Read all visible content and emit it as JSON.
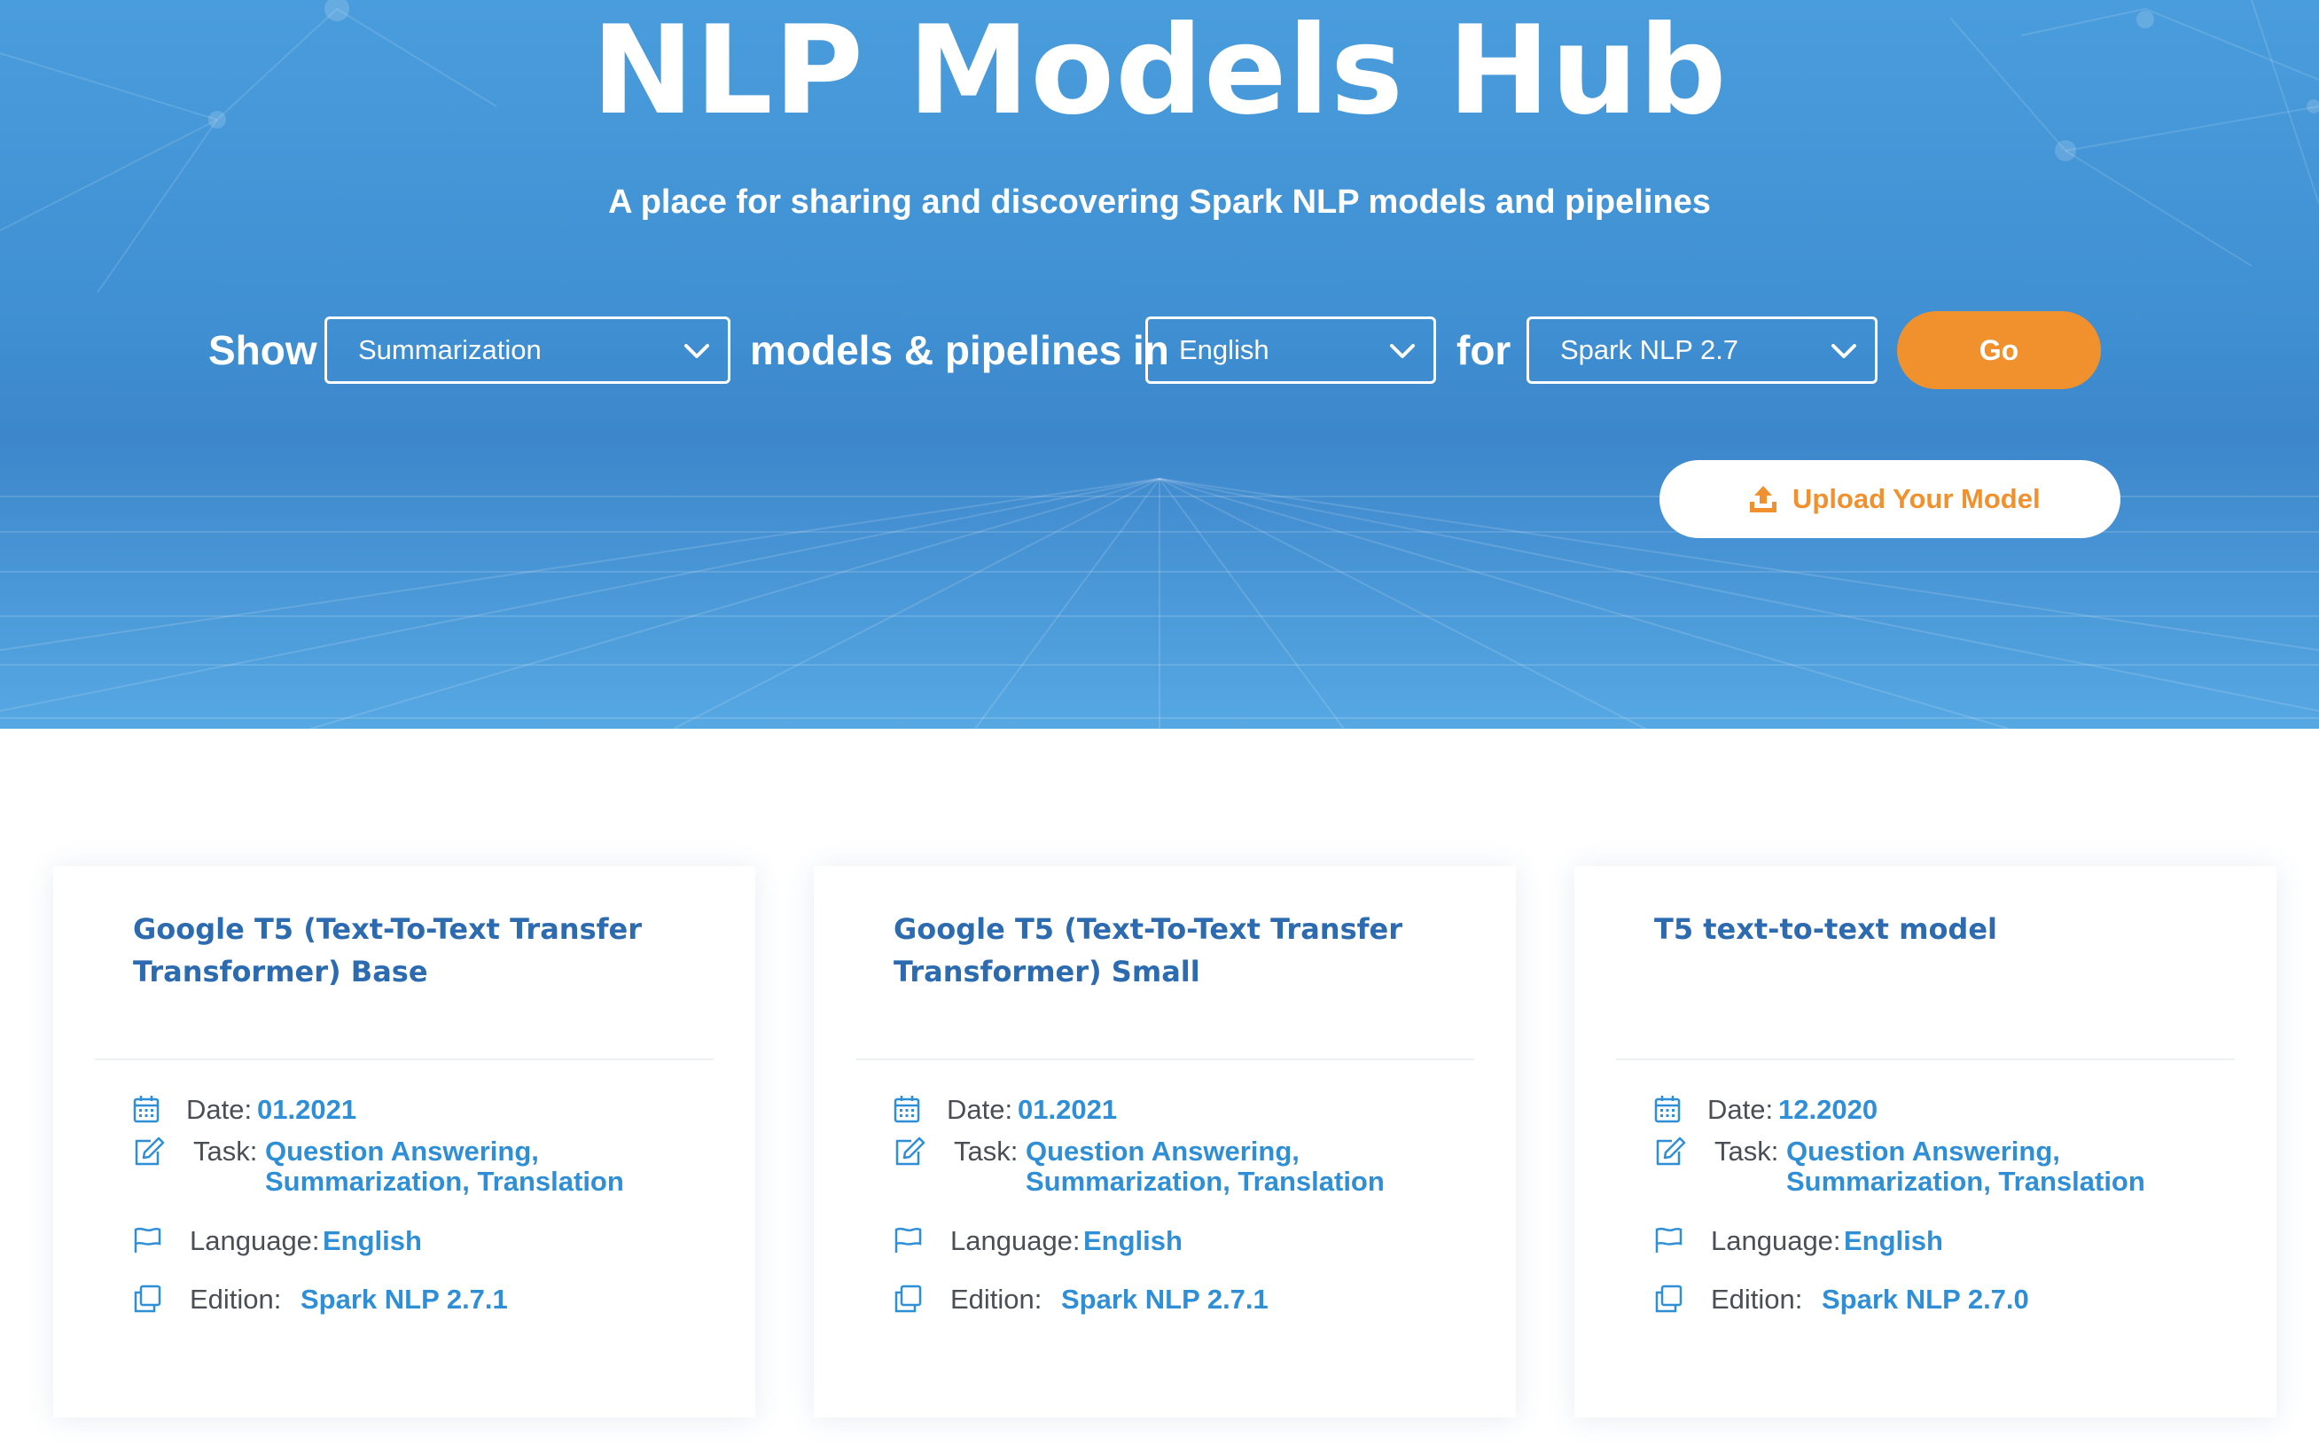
{
  "hero": {
    "title": "NLP Models Hub",
    "subtitle": "A place for sharing and discovering Spark NLP models and pipelines"
  },
  "filter": {
    "show_label": "Show",
    "task_select": "Summarization",
    "middle_label": "models & pipelines in",
    "language_select": "English",
    "for_label": "for",
    "edition_select": "Spark NLP 2.7",
    "go_button": "Go"
  },
  "upload_button": "Upload Your Model",
  "colors": {
    "hero_blue": "#3f8fd2",
    "accent_orange": "#f1912e",
    "title_blue": "#2c6bb0",
    "link_blue": "#2f8fd6"
  },
  "icons": {
    "date": "calendar-icon",
    "task": "edit-icon",
    "language": "flag-icon",
    "edition": "copy-icon",
    "upload": "upload-icon",
    "dropdown": "chevron-down-icon"
  },
  "labels": {
    "date": "Date:",
    "task": "Task:",
    "language": "Language:",
    "edition": "Edition:"
  },
  "cards": [
    {
      "title_line1": "Google T5 (Text-To-Text Transfer",
      "title_line2": "Transformer) Base",
      "date": "01.2021",
      "task_line1": "Question Answering,",
      "task_line2": "Summarization, Translation",
      "language": "English",
      "edition": "Spark NLP 2.7.1"
    },
    {
      "title_line1": "Google T5 (Text-To-Text Transfer",
      "title_line2": "Transformer) Small",
      "date": "01.2021",
      "task_line1": "Question Answering,",
      "task_line2": "Summarization, Translation",
      "language": "English",
      "edition": "Spark NLP 2.7.1"
    },
    {
      "title_line1": "T5 text-to-text model",
      "title_line2": "",
      "date": "12.2020",
      "task_line1": "Question Answering,",
      "task_line2": "Summarization, Translation",
      "language": "English",
      "edition": "Spark NLP 2.7.0"
    }
  ]
}
